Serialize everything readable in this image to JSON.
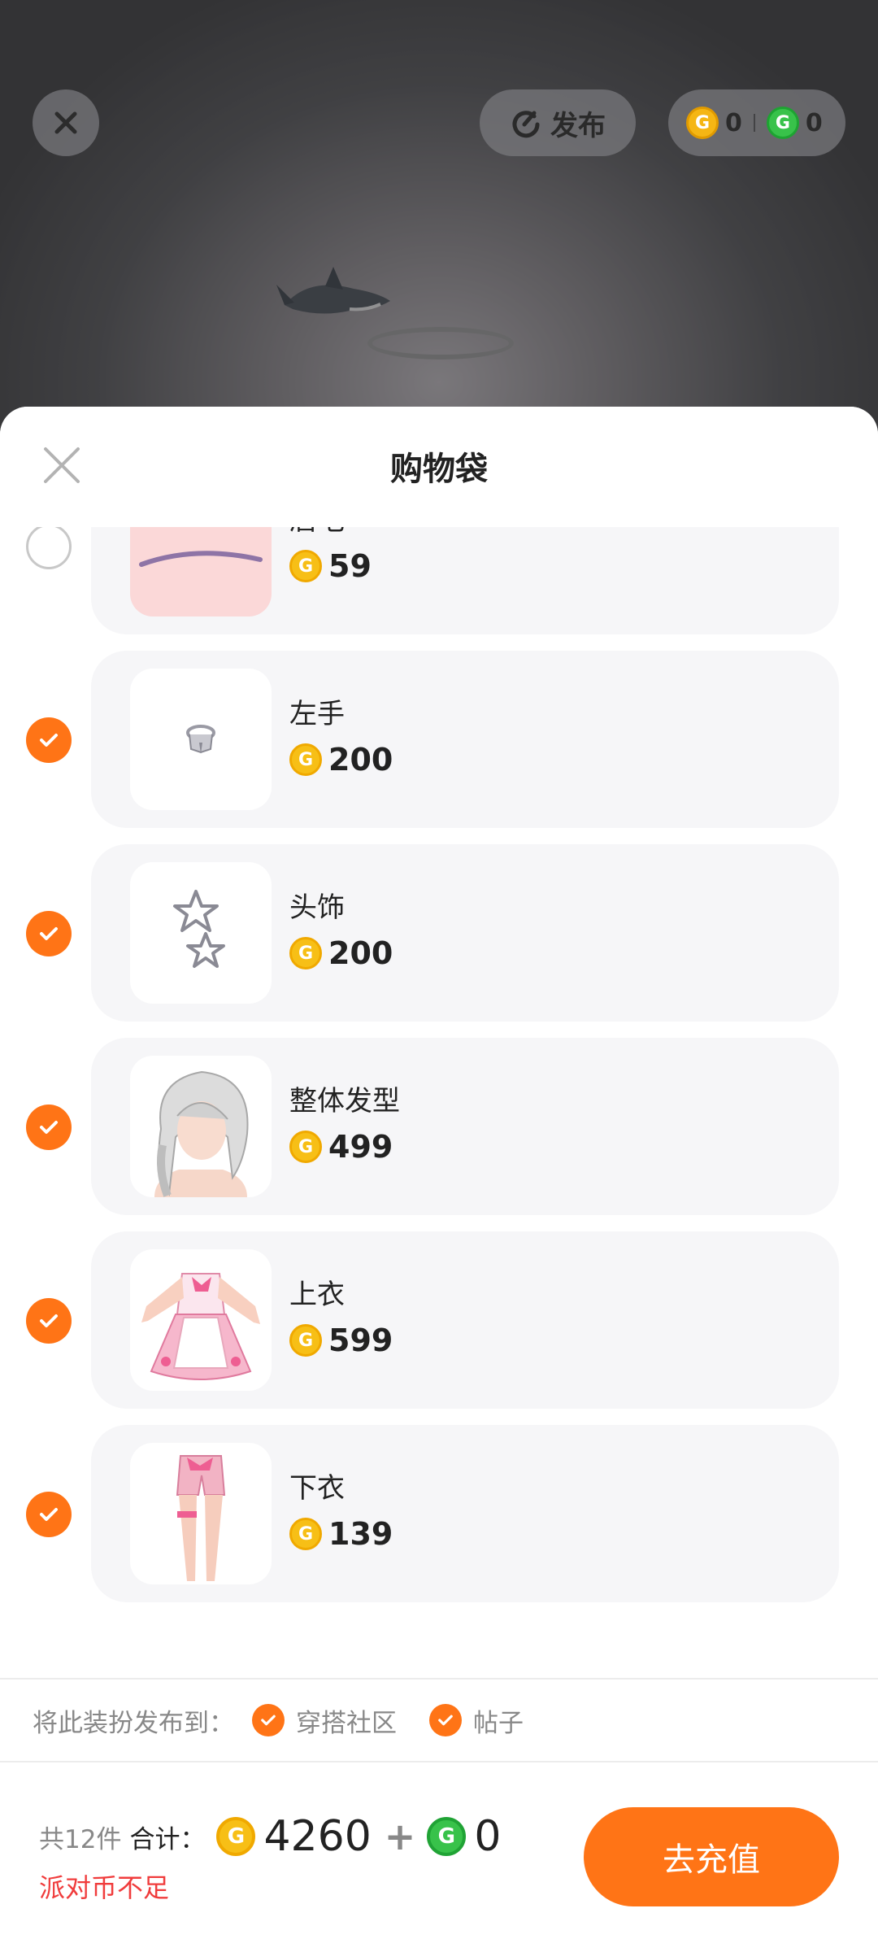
{
  "top_bar": {
    "publish_label": "发布",
    "gold_balance": "0",
    "green_balance": "0"
  },
  "sheet": {
    "title": "购物袋"
  },
  "items": [
    {
      "name": "眉毛",
      "price": "59",
      "checked": false,
      "thumb": "eyebrow"
    },
    {
      "name": "左手",
      "price": "200",
      "checked": true,
      "thumb": "ring"
    },
    {
      "name": "头饰",
      "price": "200",
      "checked": true,
      "thumb": "stars"
    },
    {
      "name": "整体发型",
      "price": "499",
      "checked": true,
      "thumb": "hair"
    },
    {
      "name": "上衣",
      "price": "599",
      "checked": true,
      "thumb": "dress"
    },
    {
      "name": "下衣",
      "price": "139",
      "checked": true,
      "thumb": "shorts"
    }
  ],
  "publish_to": {
    "label": "将此装扮发布到：",
    "options": [
      {
        "label": "穿搭社区",
        "checked": true
      },
      {
        "label": "帖子",
        "checked": true
      }
    ]
  },
  "footer": {
    "count_text": "共12件",
    "total_label": "合计：",
    "gold_total": "4260",
    "plus": "+",
    "green_total": "0",
    "warning": "派对币不足",
    "recharge_label": "去充值"
  },
  "colors": {
    "accent": "#ff7416",
    "gold_coin": "#f7bf16",
    "green_coin": "#38c24a",
    "warning": "#f03c3c"
  }
}
